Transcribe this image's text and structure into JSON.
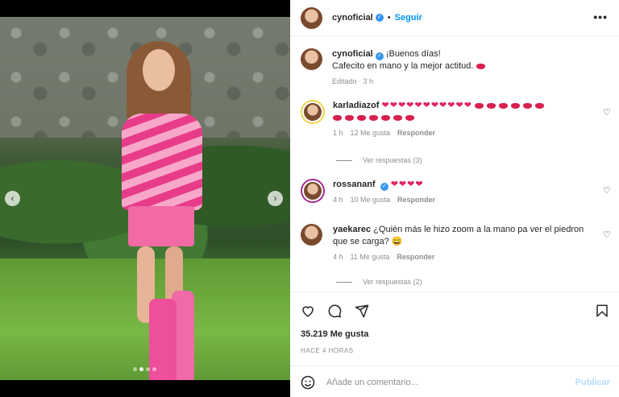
{
  "post": {
    "author": "cynoficial",
    "follow_label": "Seguir",
    "more_label": "•••",
    "separator": "•"
  },
  "caption": {
    "author": "cynoficial",
    "line1": "¡Buenos días!",
    "line2": "Cafecito en mano y la mejor actitud.",
    "edited": "Editado · 3 h"
  },
  "comments": [
    {
      "author": "karladiazof",
      "hearts": "❤❤❤❤❤❤❤❤❤❤❤",
      "lips_count_line1": 6,
      "lips_count_line2": 7,
      "time": "1 h",
      "likes": "12 Me gusta",
      "reply": "Responder",
      "view_replies": "Ver respuestas (3)"
    },
    {
      "author": "rossananf",
      "hearts": "❤❤❤❤",
      "time": "4 h",
      "likes": "10 Me gusta",
      "reply": "Responder"
    },
    {
      "author": "yaekarec",
      "text": "¿Quién más le hizo zoom a la mano pa ver el piedron que se carga? 😄",
      "time": "4 h",
      "likes": "11 Me gusta",
      "reply": "Responder",
      "view_replies": "Ver respuestas (2)"
    }
  ],
  "actions": {
    "likes": "35.219 Me gusta",
    "ago": "HACE 4 HORAS",
    "comment_placeholder": "Añade un comentario...",
    "publish": "Publicar"
  },
  "carousel": {
    "prev": "‹",
    "next": "›",
    "slide_count": 4,
    "active_slide": 2
  },
  "colors": {
    "accent": "#0095f6",
    "publish_disabled": "#b2dffc",
    "verified": "#3897f0"
  },
  "icons": [
    "heart-icon",
    "comment-icon",
    "share-icon",
    "bookmark-icon",
    "emoji-icon",
    "verified-icon",
    "more-icon"
  ]
}
